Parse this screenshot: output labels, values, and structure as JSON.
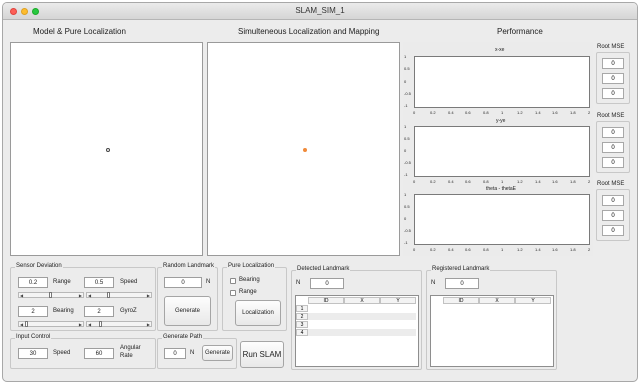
{
  "window": {
    "title": "SLAM_SIM_1"
  },
  "headers": {
    "left": "Model & Pure Localization",
    "middle": "Simulteneous Localization and Mapping",
    "right": "Performance"
  },
  "plots": [
    {
      "title": "x-xe",
      "yticks": [
        "1",
        "0.5",
        "0",
        "-0.5",
        "-1"
      ],
      "xticks": [
        "0",
        "0.2",
        "0.4",
        "0.6",
        "0.8",
        "1",
        "1.2",
        "1.4",
        "1.6",
        "1.8",
        "2"
      ]
    },
    {
      "title": "y-ye",
      "yticks": [
        "1",
        "0.5",
        "0",
        "-0.5",
        "-1"
      ],
      "xticks": [
        "0",
        "0.2",
        "0.4",
        "0.6",
        "0.8",
        "1",
        "1.2",
        "1.4",
        "1.6",
        "1.8",
        "2"
      ]
    },
    {
      "title": "theta - thetaE",
      "yticks": [
        "1",
        "0.5",
        "0",
        "-0.5",
        "-1"
      ],
      "xticks": [
        "0",
        "0.2",
        "0.4",
        "0.6",
        "0.8",
        "1",
        "1.2",
        "1.4",
        "1.6",
        "1.8",
        "2"
      ]
    }
  ],
  "root_mse": [
    {
      "label": "Root MSE",
      "values": [
        "0",
        "0",
        "0"
      ]
    },
    {
      "label": "Root MSE",
      "values": [
        "0",
        "0",
        "0"
      ]
    },
    {
      "label": "Root MSE",
      "values": [
        "0",
        "0",
        "0"
      ]
    }
  ],
  "sensor_deviation": {
    "title": "Sensor Deviation",
    "range_value": "0.2",
    "range_label": "Range",
    "speed_value": "0.5",
    "speed_label": "Speed",
    "bearing_value": "2",
    "bearing_label": "Bearing",
    "gyroz_value": "2",
    "gyroz_label": "GyroZ"
  },
  "input_control": {
    "title": "Input Control",
    "speed_value": "30",
    "speed_label": "Speed",
    "angular_value": "60",
    "angular_label_1": "Angular",
    "angular_label_2": "Rate"
  },
  "random_landmark": {
    "title": "Random Landmark",
    "value": "0",
    "unit": "N",
    "button": "Generate"
  },
  "generate_path": {
    "title": "Generate Path",
    "value": "0",
    "unit": "N",
    "button": "Generate"
  },
  "pure_localization": {
    "title": "Pure Localization",
    "bearing": "Bearing",
    "range": "Range",
    "button": "Localization"
  },
  "run_slam": {
    "label": "Run SLAM"
  },
  "detected": {
    "title": "Detected Landmark",
    "n_label": "N",
    "n_value": "0",
    "columns": [
      "ID",
      "X",
      "Y"
    ],
    "rows": [
      "1",
      "2",
      "3",
      "4"
    ]
  },
  "registered": {
    "title": "Registered Landmark",
    "n_label": "N",
    "n_value": "0",
    "columns": [
      "ID",
      "X",
      "Y"
    ]
  },
  "colors": {
    "close": "#fd5f57",
    "minimize": "#febc2e",
    "maximize": "#28c840",
    "estimate_dot": "#f08a3a"
  }
}
